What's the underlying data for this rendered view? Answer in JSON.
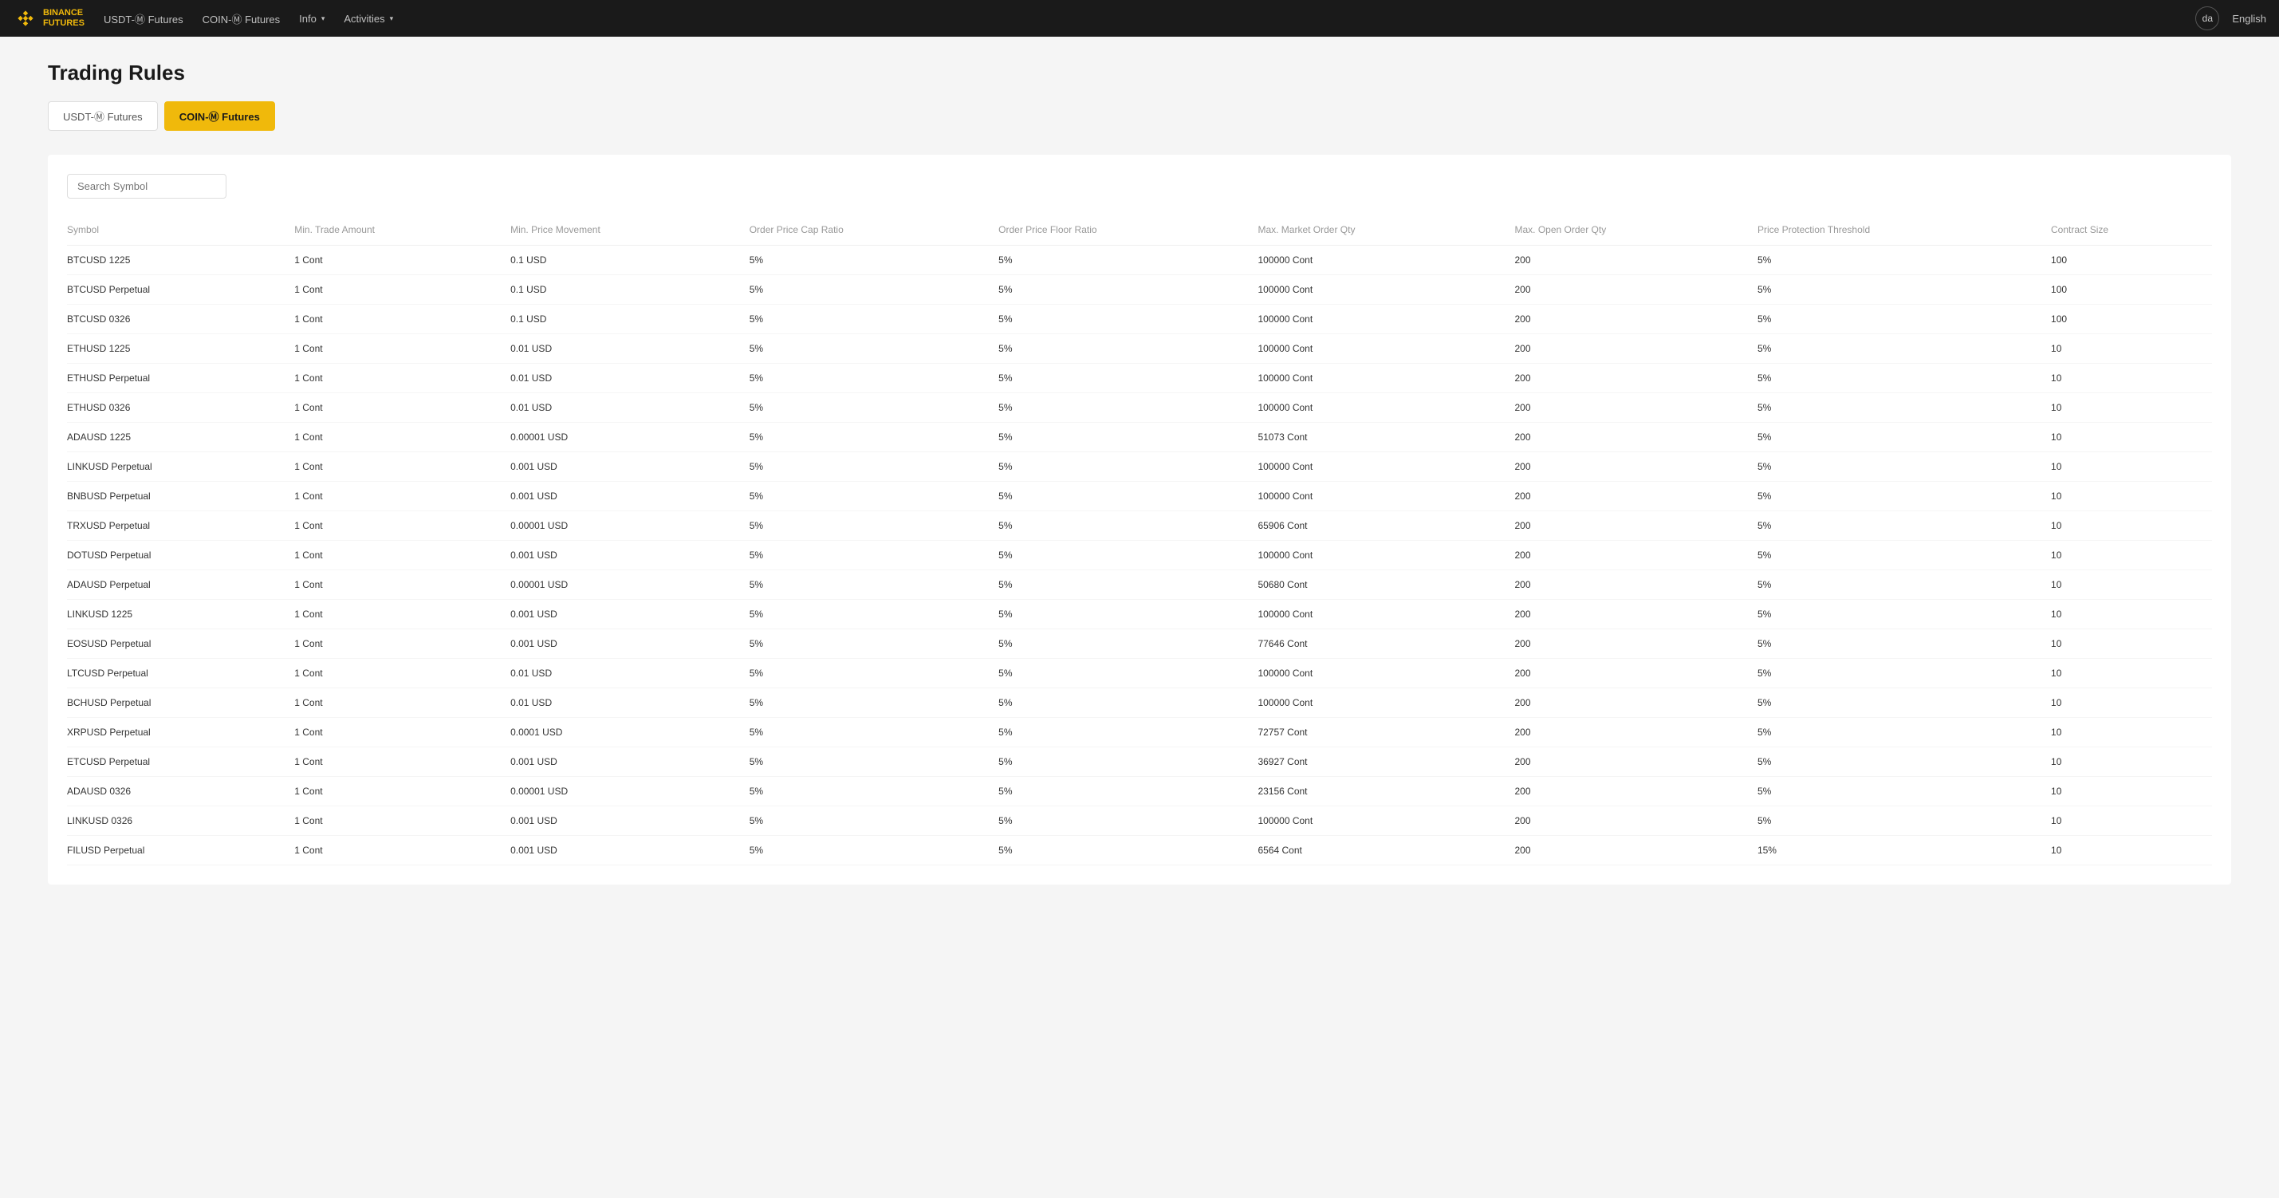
{
  "navbar": {
    "logo_text": "BINANCE\nFUTURES",
    "nav_items": [
      {
        "label": "USDT-Ⓜ Futures",
        "active": false
      },
      {
        "label": "COIN-Ⓜ Futures",
        "active": false
      },
      {
        "label": "Info",
        "has_dropdown": true
      },
      {
        "label": "Activities",
        "has_dropdown": true
      }
    ],
    "avatar_initials": "da",
    "language": "English"
  },
  "page": {
    "title": "Trading Rules",
    "tabs": [
      {
        "label": "USDT-Ⓜ Futures",
        "active": false
      },
      {
        "label": "COIN-Ⓜ Futures",
        "active": true
      }
    ]
  },
  "search": {
    "placeholder": "Search Symbol"
  },
  "table": {
    "columns": [
      "Symbol",
      "Min. Trade Amount",
      "Min. Price Movement",
      "Order Price Cap Ratio",
      "Order Price Floor Ratio",
      "Max. Market Order Qty",
      "Max. Open Order Qty",
      "Price Protection Threshold",
      "Contract Size"
    ],
    "rows": [
      {
        "symbol": "BTCUSD 1225",
        "min_trade": "1 Cont",
        "min_price": "0.1 USD",
        "price_cap": "5%",
        "price_floor": "5%",
        "max_market": "100000 Cont",
        "max_open": "200",
        "ppt": "5%",
        "contract_size": "100"
      },
      {
        "symbol": "BTCUSD Perpetual",
        "min_trade": "1 Cont",
        "min_price": "0.1 USD",
        "price_cap": "5%",
        "price_floor": "5%",
        "max_market": "100000 Cont",
        "max_open": "200",
        "ppt": "5%",
        "contract_size": "100"
      },
      {
        "symbol": "BTCUSD 0326",
        "min_trade": "1 Cont",
        "min_price": "0.1 USD",
        "price_cap": "5%",
        "price_floor": "5%",
        "max_market": "100000 Cont",
        "max_open": "200",
        "ppt": "5%",
        "contract_size": "100"
      },
      {
        "symbol": "ETHUSD 1225",
        "min_trade": "1 Cont",
        "min_price": "0.01 USD",
        "price_cap": "5%",
        "price_floor": "5%",
        "max_market": "100000 Cont",
        "max_open": "200",
        "ppt": "5%",
        "contract_size": "10"
      },
      {
        "symbol": "ETHUSD Perpetual",
        "min_trade": "1 Cont",
        "min_price": "0.01 USD",
        "price_cap": "5%",
        "price_floor": "5%",
        "max_market": "100000 Cont",
        "max_open": "200",
        "ppt": "5%",
        "contract_size": "10"
      },
      {
        "symbol": "ETHUSD 0326",
        "min_trade": "1 Cont",
        "min_price": "0.01 USD",
        "price_cap": "5%",
        "price_floor": "5%",
        "max_market": "100000 Cont",
        "max_open": "200",
        "ppt": "5%",
        "contract_size": "10"
      },
      {
        "symbol": "ADAUSD 1225",
        "min_trade": "1 Cont",
        "min_price": "0.00001 USD",
        "price_cap": "5%",
        "price_floor": "5%",
        "max_market": "51073 Cont",
        "max_open": "200",
        "ppt": "5%",
        "contract_size": "10"
      },
      {
        "symbol": "LINKUSD Perpetual",
        "min_trade": "1 Cont",
        "min_price": "0.001 USD",
        "price_cap": "5%",
        "price_floor": "5%",
        "max_market": "100000 Cont",
        "max_open": "200",
        "ppt": "5%",
        "contract_size": "10"
      },
      {
        "symbol": "BNBUSD Perpetual",
        "min_trade": "1 Cont",
        "min_price": "0.001 USD",
        "price_cap": "5%",
        "price_floor": "5%",
        "max_market": "100000 Cont",
        "max_open": "200",
        "ppt": "5%",
        "contract_size": "10"
      },
      {
        "symbol": "TRXUSD Perpetual",
        "min_trade": "1 Cont",
        "min_price": "0.00001 USD",
        "price_cap": "5%",
        "price_floor": "5%",
        "max_market": "65906 Cont",
        "max_open": "200",
        "ppt": "5%",
        "contract_size": "10"
      },
      {
        "symbol": "DOTUSD Perpetual",
        "min_trade": "1 Cont",
        "min_price": "0.001 USD",
        "price_cap": "5%",
        "price_floor": "5%",
        "max_market": "100000 Cont",
        "max_open": "200",
        "ppt": "5%",
        "contract_size": "10"
      },
      {
        "symbol": "ADAUSD Perpetual",
        "min_trade": "1 Cont",
        "min_price": "0.00001 USD",
        "price_cap": "5%",
        "price_floor": "5%",
        "max_market": "50680 Cont",
        "max_open": "200",
        "ppt": "5%",
        "contract_size": "10"
      },
      {
        "symbol": "LINKUSD 1225",
        "min_trade": "1 Cont",
        "min_price": "0.001 USD",
        "price_cap": "5%",
        "price_floor": "5%",
        "max_market": "100000 Cont",
        "max_open": "200",
        "ppt": "5%",
        "contract_size": "10"
      },
      {
        "symbol": "EOSUSD Perpetual",
        "min_trade": "1 Cont",
        "min_price": "0.001 USD",
        "price_cap": "5%",
        "price_floor": "5%",
        "max_market": "77646 Cont",
        "max_open": "200",
        "ppt": "5%",
        "contract_size": "10"
      },
      {
        "symbol": "LTCUSD Perpetual",
        "min_trade": "1 Cont",
        "min_price": "0.01 USD",
        "price_cap": "5%",
        "price_floor": "5%",
        "max_market": "100000 Cont",
        "max_open": "200",
        "ppt": "5%",
        "contract_size": "10"
      },
      {
        "symbol": "BCHUSD Perpetual",
        "min_trade": "1 Cont",
        "min_price": "0.01 USD",
        "price_cap": "5%",
        "price_floor": "5%",
        "max_market": "100000 Cont",
        "max_open": "200",
        "ppt": "5%",
        "contract_size": "10"
      },
      {
        "symbol": "XRPUSD Perpetual",
        "min_trade": "1 Cont",
        "min_price": "0.0001 USD",
        "price_cap": "5%",
        "price_floor": "5%",
        "max_market": "72757 Cont",
        "max_open": "200",
        "ppt": "5%",
        "contract_size": "10"
      },
      {
        "symbol": "ETCUSD Perpetual",
        "min_trade": "1 Cont",
        "min_price": "0.001 USD",
        "price_cap": "5%",
        "price_floor": "5%",
        "max_market": "36927 Cont",
        "max_open": "200",
        "ppt": "5%",
        "contract_size": "10"
      },
      {
        "symbol": "ADAUSD 0326",
        "min_trade": "1 Cont",
        "min_price": "0.00001 USD",
        "price_cap": "5%",
        "price_floor": "5%",
        "max_market": "23156 Cont",
        "max_open": "200",
        "ppt": "5%",
        "contract_size": "10"
      },
      {
        "symbol": "LINKUSD 0326",
        "min_trade": "1 Cont",
        "min_price": "0.001 USD",
        "price_cap": "5%",
        "price_floor": "5%",
        "max_market": "100000 Cont",
        "max_open": "200",
        "ppt": "5%",
        "contract_size": "10"
      },
      {
        "symbol": "FILUSD Perpetual",
        "min_trade": "1 Cont",
        "min_price": "0.001 USD",
        "price_cap": "5%",
        "price_floor": "5%",
        "max_market": "6564 Cont",
        "max_open": "200",
        "ppt": "15%",
        "contract_size": "10"
      }
    ]
  }
}
